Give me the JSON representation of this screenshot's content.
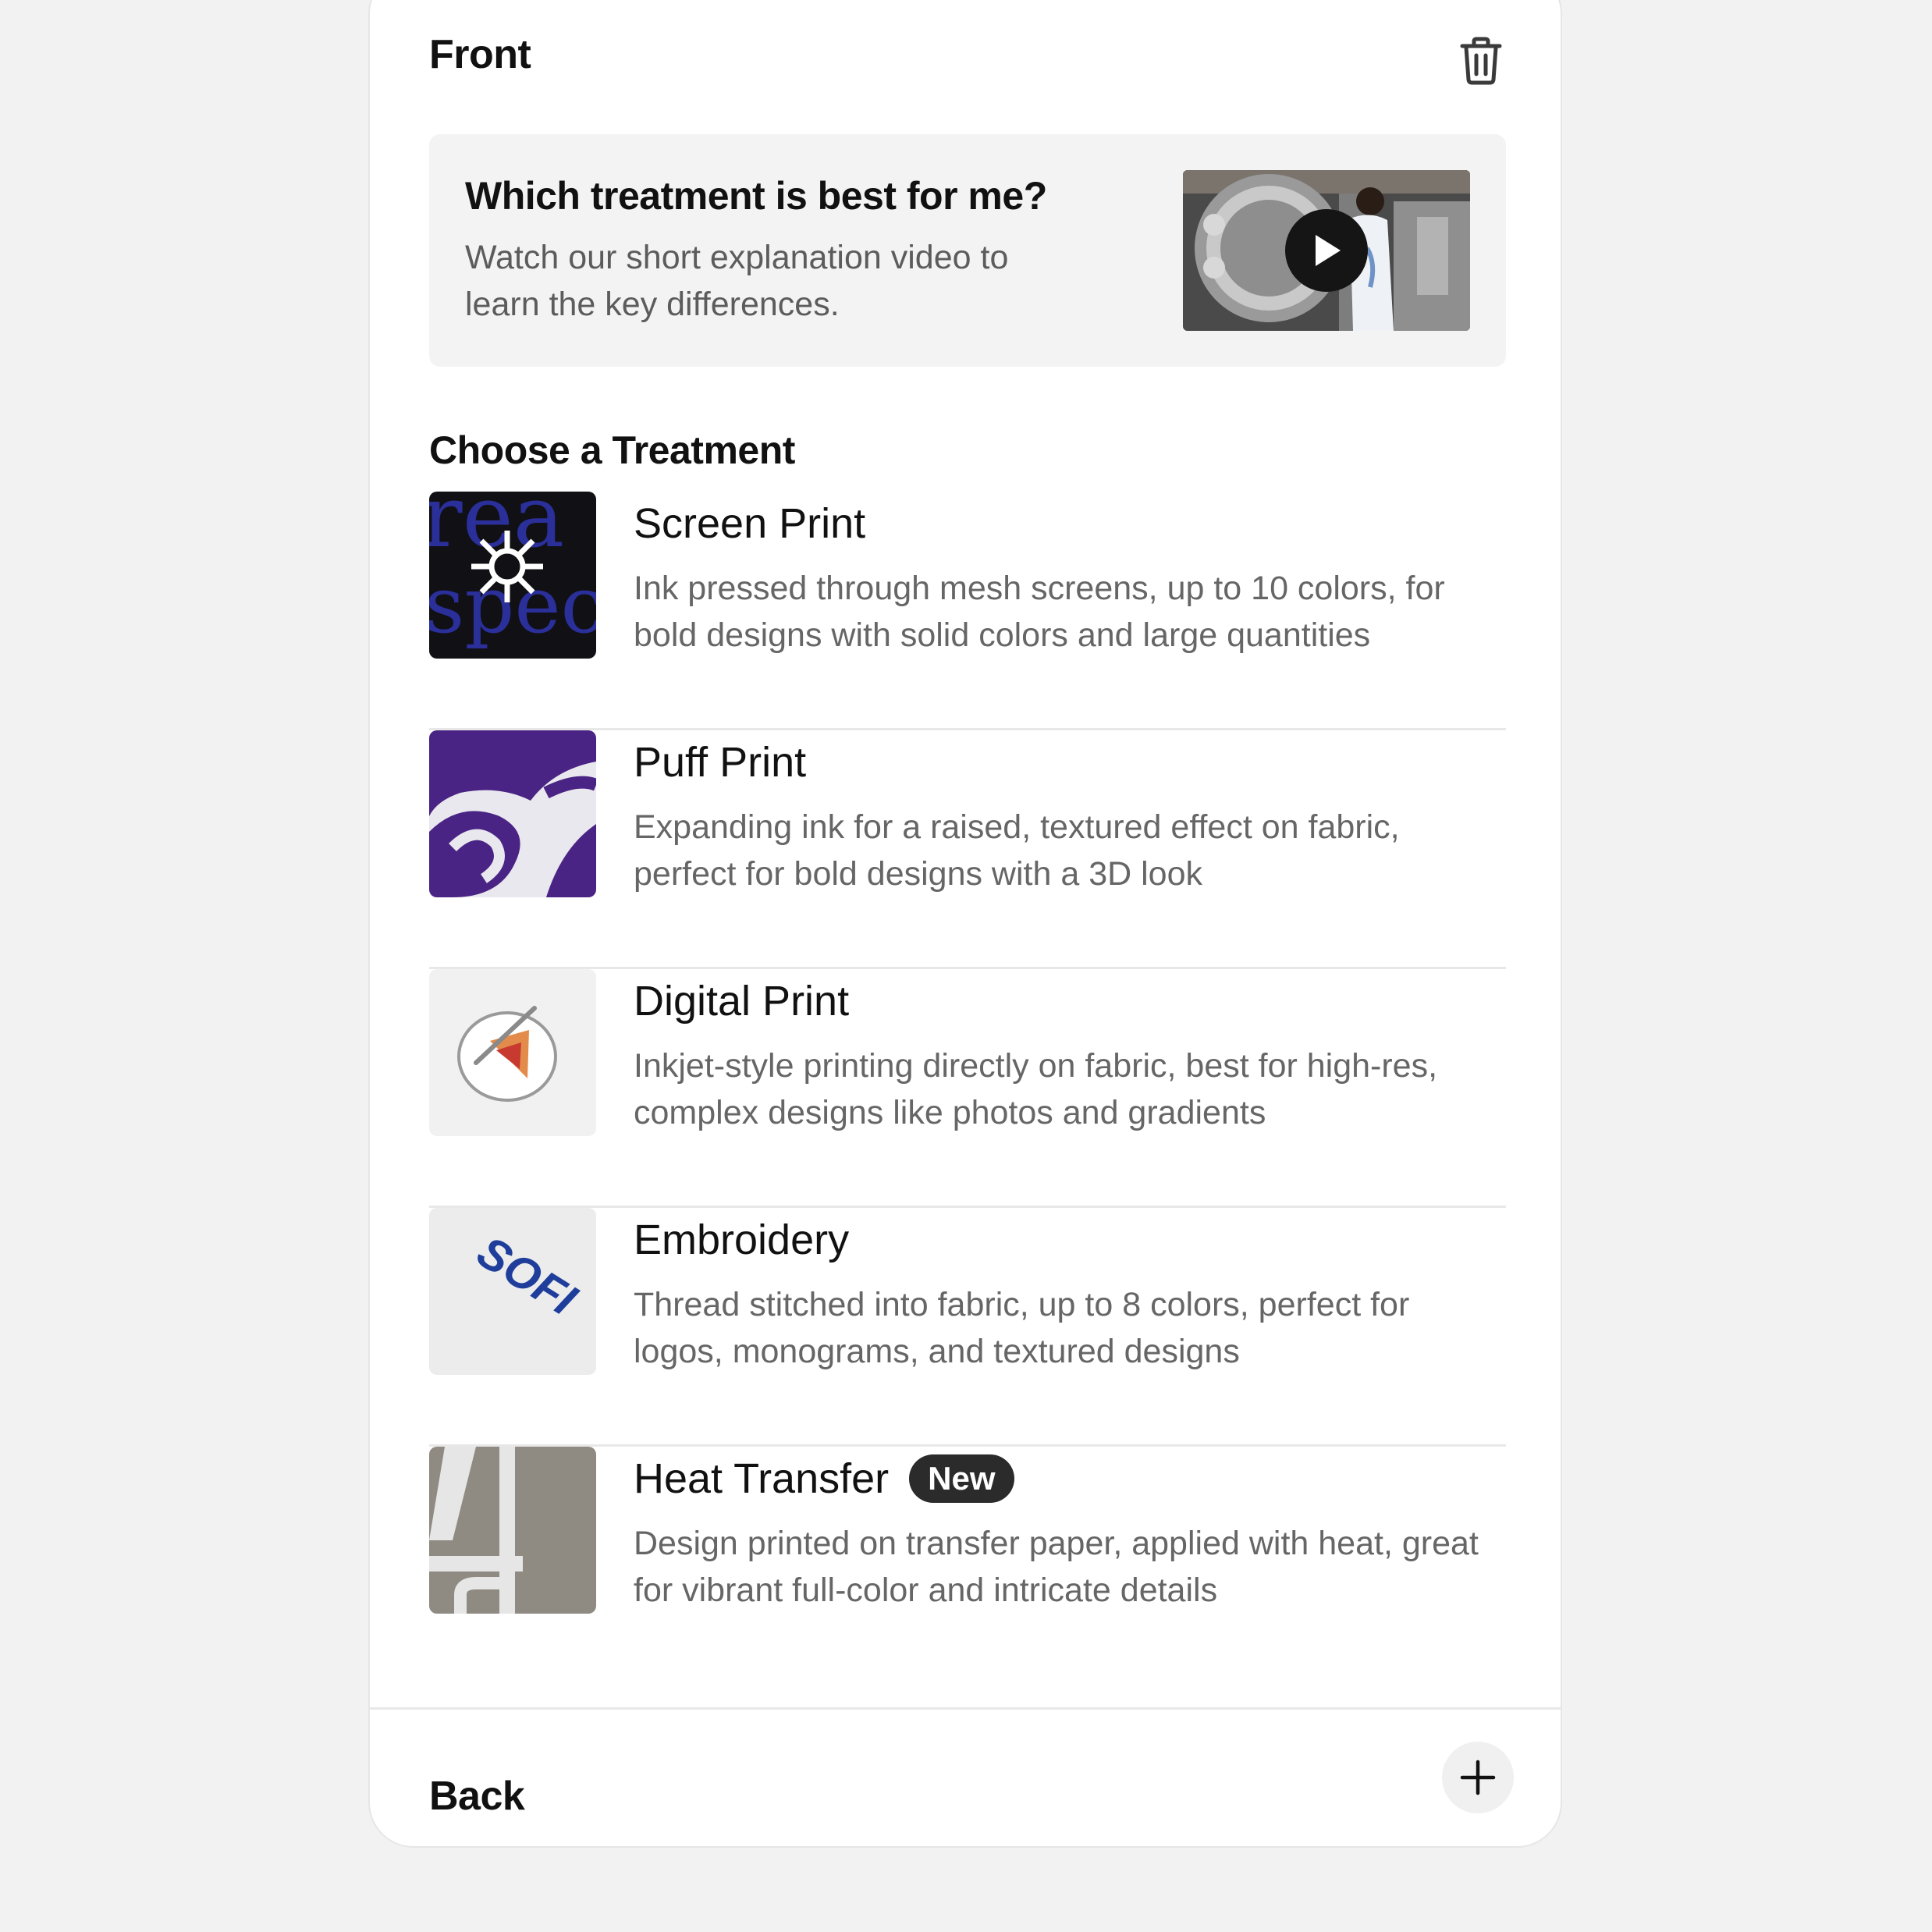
{
  "front": {
    "title": "Front",
    "delete_icon": "trash-icon"
  },
  "promo": {
    "title": "Which treatment is best for me?",
    "description": "Watch our short explanation video to learn the key differences.",
    "play_icon": "play-icon"
  },
  "treatments": {
    "heading": "Choose a Treatment",
    "items": [
      {
        "title": "Screen Print",
        "description": "Ink pressed through mesh screens, up to 10 colors, for bold designs with solid colors and large quantities",
        "badge": ""
      },
      {
        "title": "Puff Print",
        "description": "Expanding ink for a raised, textured effect on fabric, perfect for bold designs with a 3D look",
        "badge": ""
      },
      {
        "title": "Digital Print",
        "description": "Inkjet-style printing directly on fabric, best for high-res, complex designs like photos and gradients",
        "badge": ""
      },
      {
        "title": "Embroidery",
        "description": "Thread stitched into fabric, up to 8 colors, perfect for logos, monograms, and textured designs",
        "badge": "",
        "thumb_text": "SOFI"
      },
      {
        "title": "Heat Transfer",
        "description": "Design printed on transfer paper, applied with heat, great for vibrant full-color and intricate details",
        "badge": "New"
      }
    ]
  },
  "back": {
    "title": "Back",
    "add_icon": "plus-icon"
  },
  "colors": {
    "page_bg": "#f2f2f2",
    "panel_bg": "#ffffff",
    "text_primary": "#111111",
    "text_secondary": "#666666",
    "badge_bg": "#2b2b2b"
  }
}
